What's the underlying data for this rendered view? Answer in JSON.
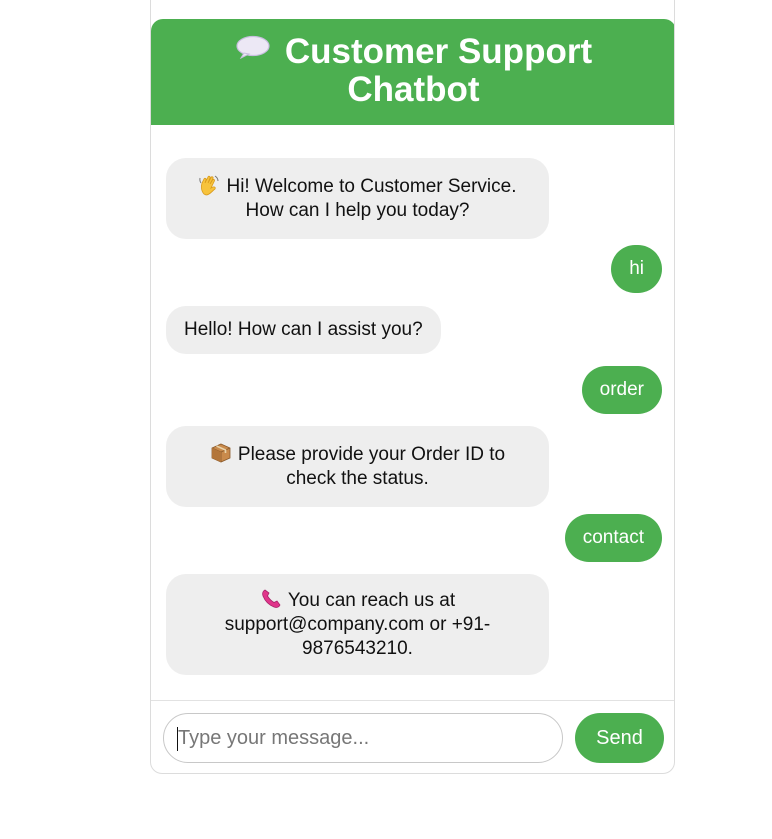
{
  "header": {
    "title": "Customer Support Chatbot",
    "icon": "speech-bubble-icon"
  },
  "messages": [
    {
      "sender": "bot",
      "icon": "waving-hand-icon",
      "text": "Hi! Welcome to Customer Service. How can I help you today?"
    },
    {
      "sender": "user",
      "text": "hi"
    },
    {
      "sender": "bot",
      "text": "Hello! How can I assist you?"
    },
    {
      "sender": "user",
      "text": "order"
    },
    {
      "sender": "bot",
      "icon": "package-icon",
      "text": "Please provide your Order ID to check the status."
    },
    {
      "sender": "user",
      "text": "contact"
    },
    {
      "sender": "bot",
      "icon": "telephone-icon",
      "text": "You can reach us at support@company.com or +91-9876543210."
    }
  ],
  "input": {
    "value": "",
    "placeholder": "Type your message..."
  },
  "send_label": "Send",
  "colors": {
    "accent": "#4caf50",
    "bot_bubble": "#eeeeee",
    "text": "#111111"
  }
}
